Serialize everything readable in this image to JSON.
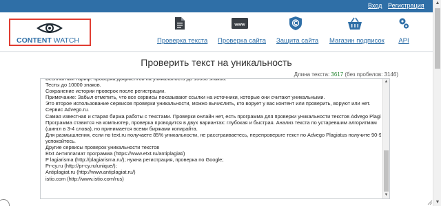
{
  "topbar": {
    "login_label": "Вход",
    "register_label": "Регистрация"
  },
  "logo": {
    "word1": "CONTENT",
    "word2": " WATCH"
  },
  "nav": {
    "items": [
      {
        "label": "Проверка текста",
        "icon": "document-icon"
      },
      {
        "label": "Проверка сайта",
        "icon": "www-icon"
      },
      {
        "label": "Защита сайта",
        "icon": "copyright-shield-icon"
      },
      {
        "label": "Магазин подписок",
        "icon": "basket-icon"
      },
      {
        "label": "API",
        "icon": "gears-icon"
      }
    ]
  },
  "main": {
    "title": "Проверить текст на уникальность",
    "length_prefix": "Длина текста: ",
    "length_value": "3617",
    "length_suffix": " (без пробелов: 3146)",
    "text_lines": [
      "Бесплатный тариф: проверка документов на уникальность до 10000 знаков.",
      "Тесты до 10000 знаков.",
      "Сохранение истории проверок после регистрации.",
      "Примечание: Забыл отметить, что все сервисы показывают ссылки на источники, которые они считают уникальными.",
      "Это второе использование сервисов проверки уникальности, можно вычислить, кто ворует у вас контент или проверить, воруют или нет.",
      "Сервис Advego.ru.",
      "Самая известная и старая биржа работы с текстами. Проверки онлайн нет, есть программа для проверки уникальности текстов Advego Plagiatus.",
      "Программа ставится на компьютер, проверка проводится в двух вариантах: глубокая и быстрая. Анализ текста по устаревшим алгоритмам",
      "(шингл в 3-4 слова), но принимается всеми биржами копирайта.",
      "Для размышления, если по text.ru получаете 85% уникальности, не расстраиваетесь, перепроверьте текст по Advego Plagiatus получите 90-95% и",
      "успокойтесь.",
      "Другие сервисы проверок уникальности текстов",
      "Etxt Антиплагиат программа (https://www.etxt.ru/antiplagiat/)",
      "P lagiarisma (http://plagiarisma.ru/); нужна регистрация, проверка по Google;",
      "Pr-cy.ru (http://pr-cy.ru/unique/);",
      "Antiplagiat.ru (http://www.antiplagiat.ru/)",
      "istio.com (http://www.istio.com/rus)"
    ]
  },
  "colors": {
    "accent": "#2f6fa7",
    "logo_border": "#e03c31",
    "length_number": "#2e8b3a"
  }
}
